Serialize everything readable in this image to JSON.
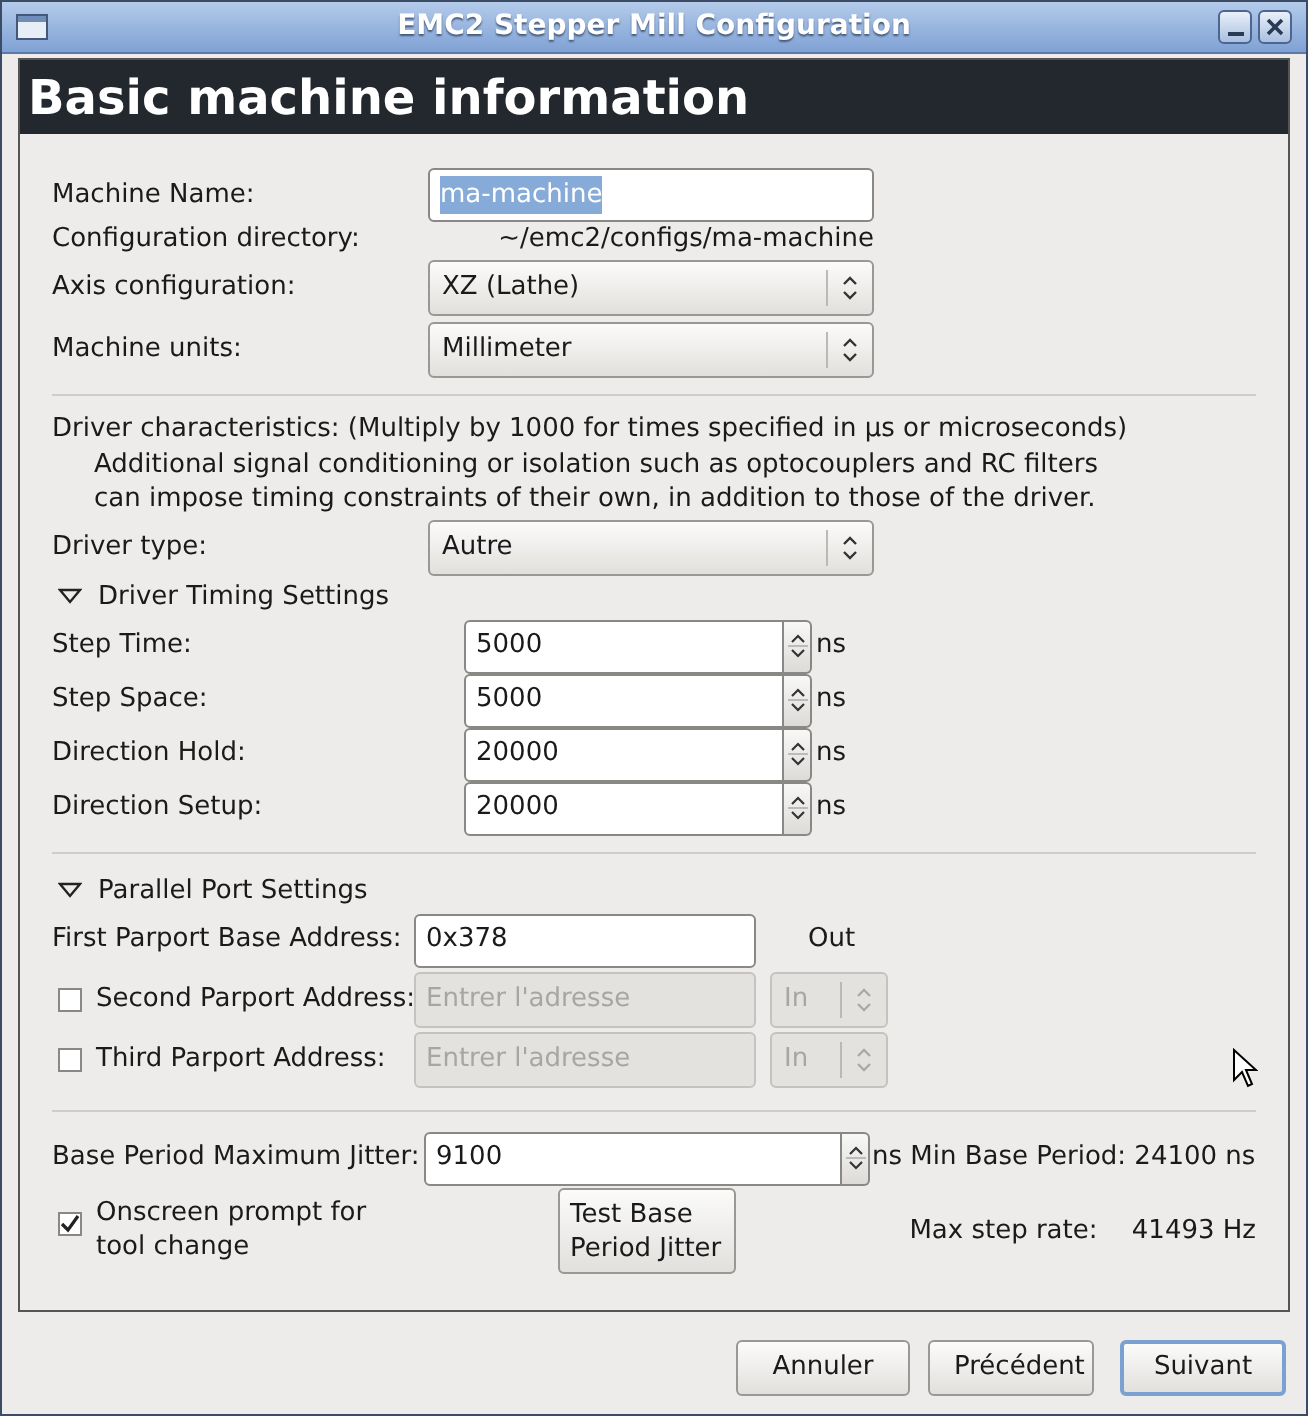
{
  "window": {
    "title": "EMC2 Stepper Mill Configuration"
  },
  "header": "Basic machine information",
  "machine": {
    "name_label": "Machine Name:",
    "name_value": "ma-machine",
    "name_text_selected": true,
    "dir_label": "Configuration directory:",
    "dir_value": "~/emc2/configs/ma-machine",
    "axis_label": "Axis configuration:",
    "axis_value": "XZ (Lathe)",
    "units_label": "Machine units:",
    "units_value": "Millimeter"
  },
  "driver": {
    "note_title": "Driver characteristics: (Multiply by 1000 for times specified in µs or microseconds)",
    "note_lines": [
      "Additional signal conditioning or isolation such as optocouplers and RC filters",
      "can impose timing constraints of their own, in addition to those of the driver."
    ],
    "type_label": "Driver type:",
    "type_value": "Autre"
  },
  "timing": {
    "title": "Driver Timing Settings",
    "expanded": true,
    "rows": [
      {
        "label": "Step Time:",
        "value": "5000",
        "unit": "ns"
      },
      {
        "label": "Step Space:",
        "value": "5000",
        "unit": "ns"
      },
      {
        "label": "Direction Hold:",
        "value": "20000",
        "unit": "ns"
      },
      {
        "label": "Direction Setup:",
        "value": "20000",
        "unit": "ns"
      }
    ]
  },
  "parport": {
    "title": "Parallel Port Settings",
    "expanded": true,
    "first": {
      "label": "First Parport Base Address:",
      "value": "0x378",
      "direction": "Out"
    },
    "others": [
      {
        "label": "Second Parport Address:",
        "checked": false,
        "disabled": true,
        "placeholder": "Entrer l'adresse",
        "direction": "In"
      },
      {
        "label": "Third Parport Address:",
        "checked": false,
        "disabled": true,
        "placeholder": "Entrer l'adresse",
        "direction": "In"
      }
    ]
  },
  "jitter": {
    "label": "Base Period Maximum Jitter:",
    "value": "9100",
    "info": "ns Min Base Period: 24100 ns"
  },
  "tool_prompt": {
    "label": "Onscreen prompt for tool change",
    "checked": true
  },
  "test_button": "Test Base Period Jitter",
  "max_step": {
    "label": "Max step rate:",
    "value": "41493 Hz"
  },
  "buttons": [
    {
      "label": "Annuler",
      "default": false
    },
    {
      "label": "Précédent",
      "default": false
    },
    {
      "label": "Suivant",
      "default": true
    }
  ]
}
